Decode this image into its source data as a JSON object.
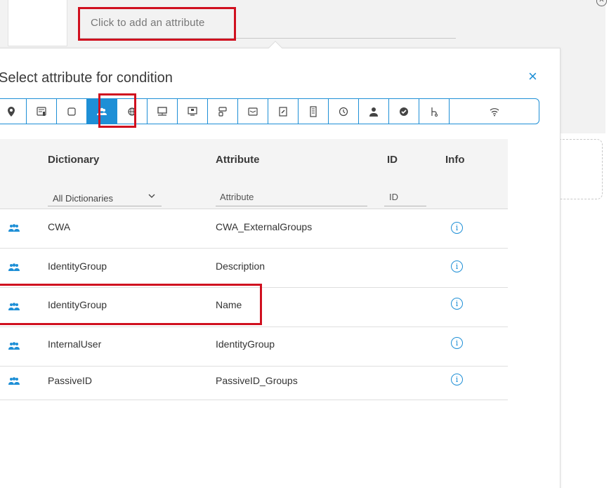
{
  "condition_editor": {
    "attribute_placeholder": "Click to add an attribute"
  },
  "popover": {
    "title": "Select attribute for condition",
    "close_glyph": "×",
    "icon_tabs": [
      {
        "icon": "location-pin-icon",
        "active": false
      },
      {
        "icon": "id-card-icon",
        "active": false
      },
      {
        "icon": "square-icon",
        "active": false
      },
      {
        "icon": "user-group-icon",
        "active": true
      },
      {
        "icon": "globe-icon",
        "active": false
      },
      {
        "icon": "network-device-icon",
        "active": false
      },
      {
        "icon": "monitor-icon",
        "active": false
      },
      {
        "icon": "hierarchy-icon",
        "active": false
      },
      {
        "icon": "envelope-icon",
        "active": false
      },
      {
        "icon": "certificate-icon",
        "active": false
      },
      {
        "icon": "document-icon",
        "active": false
      },
      {
        "icon": "clock-icon",
        "active": false
      },
      {
        "icon": "user-icon",
        "active": false
      },
      {
        "icon": "check-circle-icon",
        "active": false
      },
      {
        "icon": "flow-icon",
        "active": false
      },
      {
        "icon": "wifi-icon",
        "active": false
      }
    ],
    "table": {
      "columns": {
        "dictionary": "Dictionary",
        "attribute": "Attribute",
        "id": "ID",
        "info": "Info"
      },
      "filters": {
        "dictionary_selected": "All Dictionaries",
        "attribute_placeholder": "Attribute",
        "id_placeholder": "ID"
      },
      "rows": [
        {
          "dictionary": "CWA",
          "attribute": "CWA_ExternalGroups",
          "info": "i"
        },
        {
          "dictionary": "IdentityGroup",
          "attribute": "Description",
          "info": "i"
        },
        {
          "dictionary": "IdentityGroup",
          "attribute": "Name",
          "info": "i"
        },
        {
          "dictionary": "InternalUser",
          "attribute": "IdentityGroup",
          "info": "i"
        },
        {
          "dictionary": "PassiveID",
          "attribute": "PassiveID_Groups",
          "info": "i"
        }
      ]
    }
  },
  "colors": {
    "accent": "#1e8fd6",
    "highlight": "#d0101f"
  }
}
